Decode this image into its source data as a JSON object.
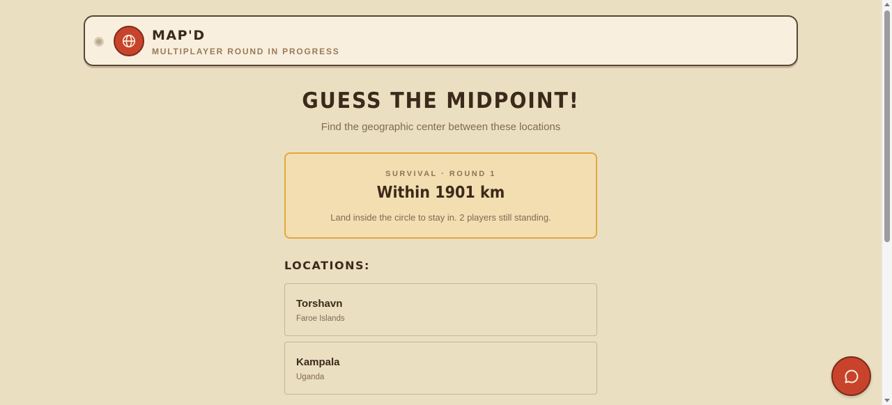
{
  "header": {
    "brand_title": "MAP'D",
    "brand_subtitle": "MULTIPLAYER ROUND IN PROGRESS",
    "logo_icon": "globe-icon",
    "status_dot_color": "#b8a98f"
  },
  "main": {
    "title": "GUESS THE MIDPOINT!",
    "subtitle": "Find the geographic center between these locations"
  },
  "round_card": {
    "label": "SURVIVAL · ROUND 1",
    "target": "Within 1901 km",
    "note": "Land inside the circle to stay in. 2 players still standing."
  },
  "locations": {
    "heading": "LOCATIONS:",
    "items": [
      {
        "name": "Torshavn",
        "country": "Faroe Islands"
      },
      {
        "name": "Kampala",
        "country": "Uganda"
      }
    ]
  },
  "chat": {
    "icon": "chat-bubble-icon"
  },
  "colors": {
    "background": "#ebdfc2",
    "accent": "#c8432b",
    "card_border": "#e0a93c",
    "text_dark": "#3b2a1a"
  }
}
